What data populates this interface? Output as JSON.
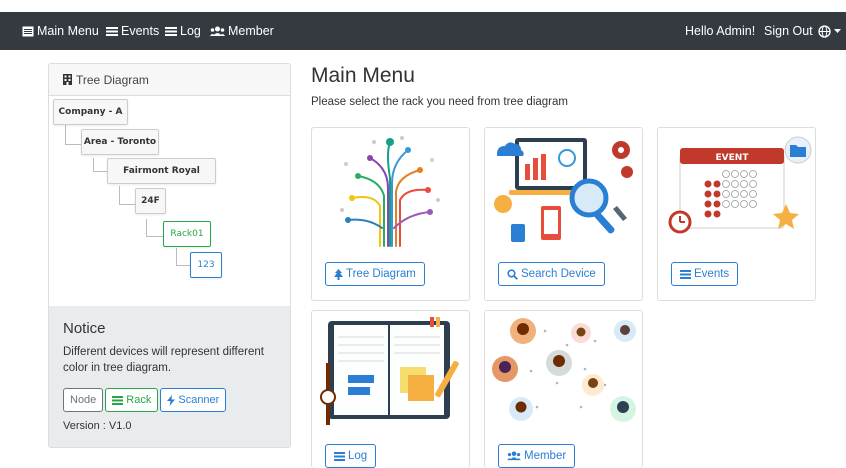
{
  "navbar": {
    "items": [
      {
        "label": "Main Menu",
        "icon": "list-alt-icon"
      },
      {
        "label": "Events",
        "icon": "list-icon"
      },
      {
        "label": "Log",
        "icon": "list-icon"
      },
      {
        "label": "Member",
        "icon": "users-icon"
      }
    ],
    "greeting": "Hello Admin!",
    "sign_out": "Sign Out",
    "globe_icon": "globe-icon"
  },
  "sidebar": {
    "title": "Tree Diagram",
    "tree": [
      {
        "label": "Company - A",
        "kind": "node"
      },
      {
        "label": "Area - Toronto",
        "kind": "node"
      },
      {
        "label": "Fairmont Royal",
        "kind": "node"
      },
      {
        "label": "24F",
        "kind": "node"
      },
      {
        "label": "Rack01",
        "kind": "rack"
      },
      {
        "label": "123",
        "kind": "scanner"
      }
    ],
    "notice": {
      "title": "Notice",
      "text": "Different devices will represent different color in tree diagram.",
      "legend": [
        {
          "label": "Node",
          "color": "#6c757d"
        },
        {
          "label": "Rack",
          "color": "#28a745"
        },
        {
          "label": "Scanner",
          "color": "#2a7fd4"
        }
      ],
      "version": "Version : V1.0"
    }
  },
  "main": {
    "title": "Main Menu",
    "subtitle": "Please select the rack you need from tree diagram",
    "cards": [
      {
        "button": "Tree Diagram",
        "icon": "tree-icon"
      },
      {
        "button": "Search Device",
        "icon": "search-icon"
      },
      {
        "button": "Events",
        "icon": "list-icon"
      },
      {
        "button": "Log",
        "icon": "list-icon"
      },
      {
        "button": "Member",
        "icon": "users-icon"
      }
    ],
    "event_calendar_label": "EVENT"
  },
  "colors": {
    "navbar_bg": "#343a40",
    "primary": "#2a7fd4",
    "success": "#28a745",
    "secondary": "#6c757d"
  }
}
